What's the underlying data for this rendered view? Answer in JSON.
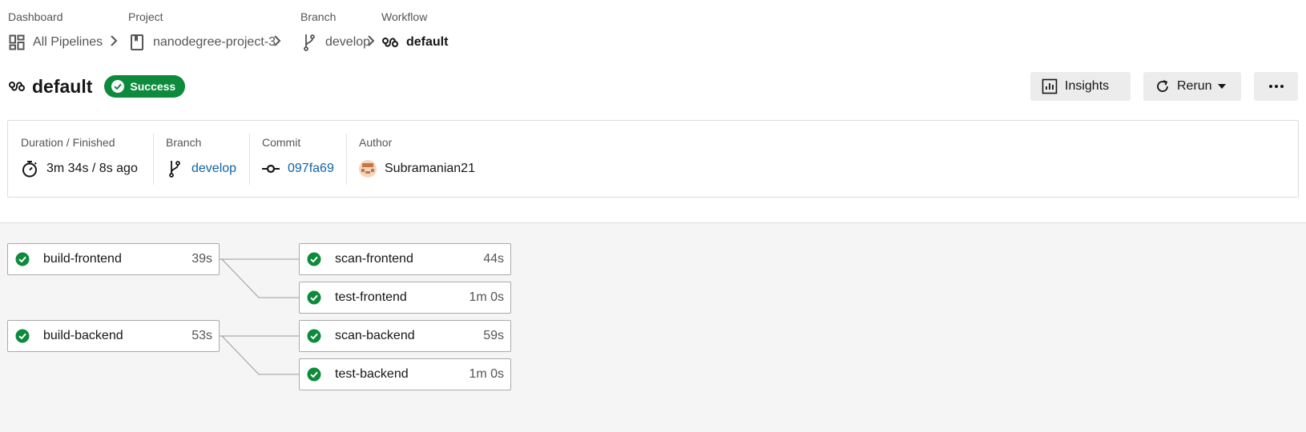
{
  "breadcrumb": {
    "dashboard": {
      "label": "Dashboard",
      "value": "All Pipelines"
    },
    "project": {
      "label": "Project",
      "value": "nanodegree-project-3"
    },
    "branch": {
      "label": "Branch",
      "value": "develop"
    },
    "workflow": {
      "label": "Workflow",
      "value": "default"
    }
  },
  "header": {
    "title": "default",
    "status": "Success",
    "status_color": "#0d8a3c",
    "insights_label": "Insights",
    "rerun_label": "Rerun",
    "more_icon": "more-horizontal-icon"
  },
  "summary": {
    "duration": {
      "label": "Duration / Finished",
      "value": "3m 34s / 8s ago"
    },
    "branch": {
      "label": "Branch",
      "value": "develop"
    },
    "commit": {
      "label": "Commit",
      "value": "097fa69"
    },
    "author": {
      "label": "Author",
      "value": "Subramanian21"
    }
  },
  "jobs": [
    {
      "name": "build-frontend",
      "duration": "39s",
      "status": "success"
    },
    {
      "name": "scan-frontend",
      "duration": "44s",
      "status": "success"
    },
    {
      "name": "test-frontend",
      "duration": "1m 0s",
      "status": "success"
    },
    {
      "name": "build-backend",
      "duration": "53s",
      "status": "success"
    },
    {
      "name": "scan-backend",
      "duration": "59s",
      "status": "success"
    },
    {
      "name": "test-backend",
      "duration": "1m 0s",
      "status": "success"
    }
  ],
  "colors": {
    "success": "#0d8a3c",
    "link": "#1064a6"
  }
}
